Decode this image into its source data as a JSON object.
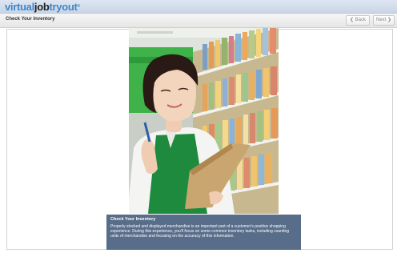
{
  "header": {
    "logo_part1": "virtual",
    "logo_part2": "job",
    "logo_part3": "tryout",
    "logo_mark": "®"
  },
  "toolbar": {
    "page_title": "Check Your Inventory",
    "back_label": "❮ Back",
    "next_label": "Next ❯"
  },
  "caption": {
    "title": "Check Your Inventory",
    "body": "Properly stocked and displayed merchandise is an important part of a customer's positive shopping experience. During this experience, you'll focus on some common inventory tasks, including counting units of merchandise and focusing on the accuracy of this information."
  },
  "colors": {
    "brand_blue": "#3f86c7",
    "caption_bg": "#4a6280",
    "apron_green": "#1e8a3e",
    "store_sign_green": "#3fb24a"
  },
  "icons": [
    "back-chevron-icon",
    "next-chevron-icon"
  ]
}
